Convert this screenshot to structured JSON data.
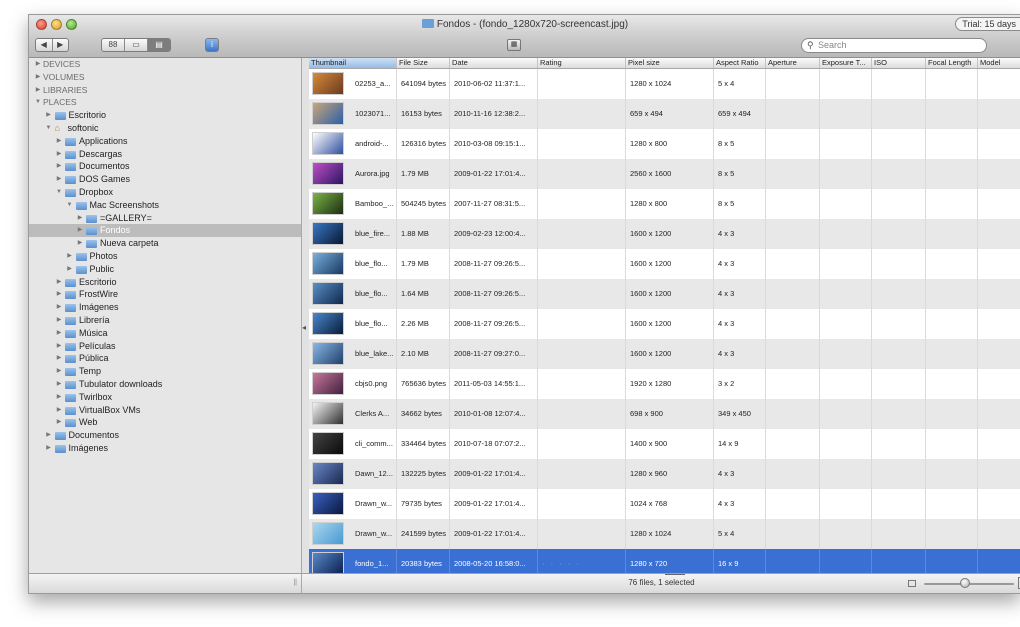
{
  "window": {
    "title": "Fondos - (fondo_1280x720-screencast.jpg)",
    "trial_badge": "Trial: 15 days"
  },
  "toolbar": {
    "back_glyph": "◀",
    "forward_glyph": "▶",
    "view_modes": [
      "88",
      "▭",
      "▤"
    ],
    "search_placeholder": "Search"
  },
  "sidebar": {
    "items": [
      {
        "label": "DEVICES",
        "indent": 0,
        "type": "section",
        "arrow": "▶"
      },
      {
        "label": "VOLUMES",
        "indent": 0,
        "type": "section",
        "arrow": "▶"
      },
      {
        "label": "LIBRARIES",
        "indent": 0,
        "type": "section",
        "arrow": "▶"
      },
      {
        "label": "PLACES",
        "indent": 0,
        "type": "section",
        "arrow": "▼"
      },
      {
        "label": "Escritorio",
        "indent": 1,
        "type": "folder",
        "arrow": "▶"
      },
      {
        "label": "softonic",
        "indent": 1,
        "type": "home",
        "arrow": "▼"
      },
      {
        "label": "Applications",
        "indent": 2,
        "type": "folder",
        "arrow": "▶"
      },
      {
        "label": "Descargas",
        "indent": 2,
        "type": "folder",
        "arrow": "▶"
      },
      {
        "label": "Documentos",
        "indent": 2,
        "type": "folder",
        "arrow": "▶"
      },
      {
        "label": "DOS Games",
        "indent": 2,
        "type": "folder",
        "arrow": "▶"
      },
      {
        "label": "Dropbox",
        "indent": 2,
        "type": "folder",
        "arrow": "▼"
      },
      {
        "label": "Mac Screenshots",
        "indent": 3,
        "type": "folder",
        "arrow": "▼"
      },
      {
        "label": "=GALLERY=",
        "indent": 4,
        "type": "folder",
        "arrow": "▶"
      },
      {
        "label": "Fondos",
        "indent": 4,
        "type": "folder",
        "arrow": "▶",
        "selected": true
      },
      {
        "label": "Nueva carpeta",
        "indent": 4,
        "type": "folder",
        "arrow": "▶"
      },
      {
        "label": "Photos",
        "indent": 3,
        "type": "folder",
        "arrow": "▶"
      },
      {
        "label": "Public",
        "indent": 3,
        "type": "folder",
        "arrow": "▶"
      },
      {
        "label": "Escritorio",
        "indent": 2,
        "type": "folder",
        "arrow": "▶"
      },
      {
        "label": "FrostWire",
        "indent": 2,
        "type": "folder",
        "arrow": "▶"
      },
      {
        "label": "Imágenes",
        "indent": 2,
        "type": "folder",
        "arrow": "▶"
      },
      {
        "label": "Librería",
        "indent": 2,
        "type": "folder",
        "arrow": "▶"
      },
      {
        "label": "Música",
        "indent": 2,
        "type": "folder",
        "arrow": "▶"
      },
      {
        "label": "Películas",
        "indent": 2,
        "type": "folder",
        "arrow": "▶"
      },
      {
        "label": "Pública",
        "indent": 2,
        "type": "folder",
        "arrow": "▶"
      },
      {
        "label": "Temp",
        "indent": 2,
        "type": "folder",
        "arrow": "▶"
      },
      {
        "label": "Tubulator downloads",
        "indent": 2,
        "type": "folder",
        "arrow": "▶"
      },
      {
        "label": "Twirlbox",
        "indent": 2,
        "type": "folder",
        "arrow": "▶"
      },
      {
        "label": "VirtualBox VMs",
        "indent": 2,
        "type": "folder",
        "arrow": "▶"
      },
      {
        "label": "Web",
        "indent": 2,
        "type": "folder",
        "arrow": "▶"
      },
      {
        "label": "Documentos",
        "indent": 1,
        "type": "folder",
        "arrow": "▶"
      },
      {
        "label": "Imágenes",
        "indent": 1,
        "type": "folder",
        "arrow": "▶"
      }
    ]
  },
  "table": {
    "columns": [
      "Thumbnail",
      "File Size",
      "Date",
      "Rating",
      "Pixel size",
      "Aspect Ratio",
      "Aperture",
      "Exposure T...",
      "ISO",
      "Focal Length",
      "Model"
    ],
    "rows": [
      {
        "name": "02253_a...",
        "size": "641094 bytes",
        "date": "2010-06-02 11:37:1...",
        "rating": "",
        "pixels": "1280 x 1024",
        "aspect": "5 x 4",
        "thumb": [
          "#d98a3a",
          "#6a3a20"
        ]
      },
      {
        "name": "1023071...",
        "size": "16153 bytes",
        "date": "2010-11-16 12:38:2...",
        "rating": "",
        "pixels": "659 x 494",
        "aspect": "659 x 494",
        "thumb": [
          "#c9a67a",
          "#2c5fa8"
        ]
      },
      {
        "name": "android-...",
        "size": "126316 bytes",
        "date": "2010-03-08 09:15:1...",
        "rating": "",
        "pixels": "1280 x 800",
        "aspect": "8 x 5",
        "thumb": [
          "#ffffff",
          "#2f4f9f"
        ]
      },
      {
        "name": "Aurora.jpg",
        "size": "1.79 MB",
        "date": "2009-01-22 17:01:4...",
        "rating": "",
        "pixels": "2560 x 1600",
        "aspect": "8 x 5",
        "thumb": [
          "#c050c8",
          "#2a1660"
        ]
      },
      {
        "name": "Bamboo_...",
        "size": "504245 bytes",
        "date": "2007-11-27 08:31:5...",
        "rating": "",
        "pixels": "1280 x 800",
        "aspect": "8 x 5",
        "thumb": [
          "#7ab648",
          "#1c2c10"
        ]
      },
      {
        "name": "blue_fire...",
        "size": "1.88 MB",
        "date": "2009-02-23 12:00:4...",
        "rating": "",
        "pixels": "1600 x 1200",
        "aspect": "4 x 3",
        "thumb": [
          "#3a78c8",
          "#081830"
        ]
      },
      {
        "name": "blue_flo...",
        "size": "1.79 MB",
        "date": "2008-11-27 09:26:5...",
        "rating": "",
        "pixels": "1600 x 1200",
        "aspect": "4 x 3",
        "thumb": [
          "#7ab0e0",
          "#183860"
        ]
      },
      {
        "name": "blue_flo...",
        "size": "1.64 MB",
        "date": "2008-11-27 09:26:5...",
        "rating": "",
        "pixels": "1600 x 1200",
        "aspect": "4 x 3",
        "thumb": [
          "#5a90c8",
          "#10284c"
        ]
      },
      {
        "name": "blue_flo...",
        "size": "2.26 MB",
        "date": "2008-11-27 09:26:5...",
        "rating": "",
        "pixels": "1600 x 1200",
        "aspect": "4 x 3",
        "thumb": [
          "#4a88d0",
          "#081c38"
        ]
      },
      {
        "name": "blue_lake...",
        "size": "2.10 MB",
        "date": "2008-11-27 09:27:0...",
        "rating": "",
        "pixels": "1600 x 1200",
        "aspect": "4 x 3",
        "thumb": [
          "#8ab8e8",
          "#20406a"
        ]
      },
      {
        "name": "cbjs0.png",
        "size": "765636 bytes",
        "date": "2011-05-03 14:55:1...",
        "rating": "",
        "pixels": "1920 x 1280",
        "aspect": "3 x 2",
        "thumb": [
          "#c87898",
          "#402040"
        ]
      },
      {
        "name": "Clerks A...",
        "size": "34662 bytes",
        "date": "2010-01-08 12:07:4...",
        "rating": "",
        "pixels": "698 x 900",
        "aspect": "349 x 450",
        "thumb": [
          "#f4f4f4",
          "#303030"
        ]
      },
      {
        "name": "cli_comm...",
        "size": "334464 bytes",
        "date": "2010-07-18 07:07:2...",
        "rating": "",
        "pixels": "1400 x 900",
        "aspect": "14 x 9",
        "thumb": [
          "#444444",
          "#0a0a0a"
        ]
      },
      {
        "name": "Dawn_12...",
        "size": "132225 bytes",
        "date": "2009-01-22 17:01:4...",
        "rating": "",
        "pixels": "1280 x 960",
        "aspect": "4 x 3",
        "thumb": [
          "#6a88c8",
          "#1a2850"
        ]
      },
      {
        "name": "Drawn_w...",
        "size": "79735 bytes",
        "date": "2009-01-22 17:01:4...",
        "rating": "",
        "pixels": "1024 x 768",
        "aspect": "4 x 3",
        "thumb": [
          "#3a60c0",
          "#0a1840"
        ]
      },
      {
        "name": "Drawn_w...",
        "size": "241599 bytes",
        "date": "2009-01-22 17:01:4...",
        "rating": "",
        "pixels": "1280 x 1024",
        "aspect": "5 x 4",
        "thumb": [
          "#a8d8f0",
          "#4a98d0"
        ]
      },
      {
        "name": "fondo_1...",
        "size": "20383 bytes",
        "date": "2008-05-20 16:58:0...",
        "rating": "· · · · ·",
        "pixels": "1280 x 720",
        "aspect": "16 x 9",
        "thumb": [
          "#5a88c8",
          "#0a2050"
        ],
        "selected": true
      }
    ]
  },
  "status": {
    "text": "76 files, 1 selected",
    "zoom_level": 0.45
  }
}
